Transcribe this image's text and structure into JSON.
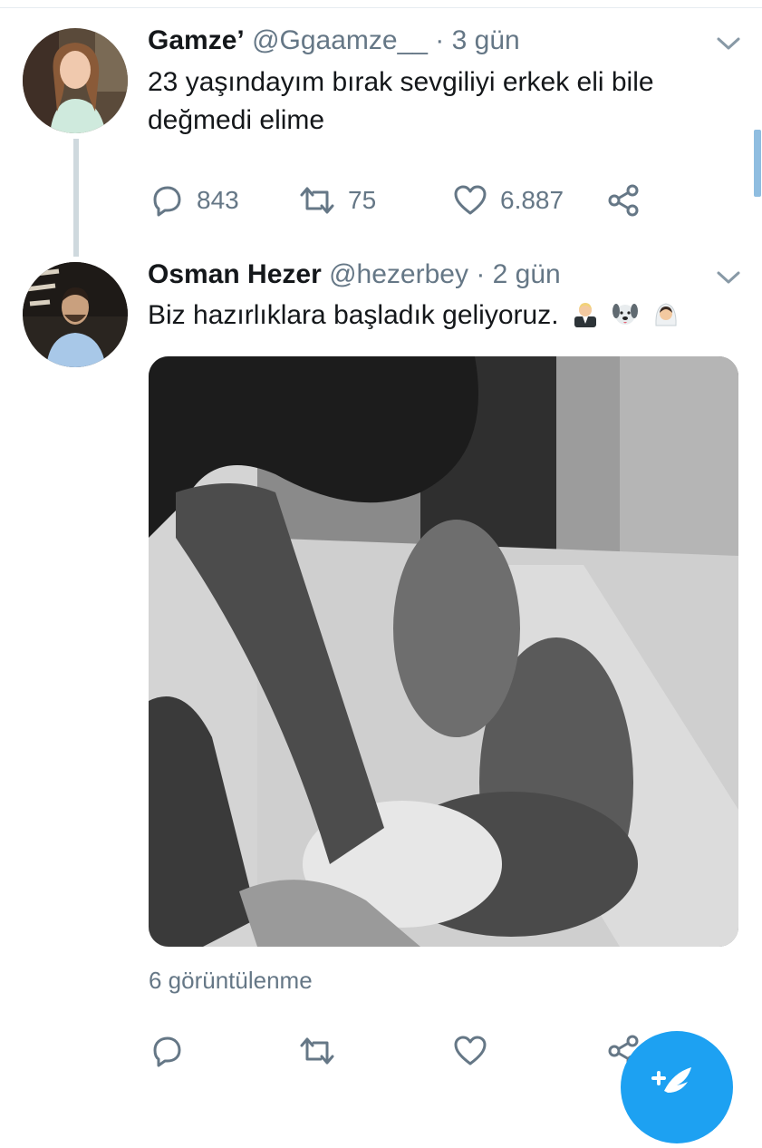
{
  "tweets": [
    {
      "name": "Gamze’",
      "handle": "@Ggaamze__",
      "separator": "·",
      "time": "3 gün",
      "text": "23 yaşındayım bırak sevgiliyi erkek eli bile değmedi elime",
      "replies": "843",
      "retweets": "75",
      "likes": "6.887"
    },
    {
      "name": "Osman Hezer",
      "handle": "@hezerbey",
      "separator": "·",
      "time": "2 gün",
      "text": "Biz hazırlıklara başladık geliyoruz.",
      "emojis": [
        "groom-emoji",
        "dog-emoji",
        "bride-emoji"
      ],
      "views": "6 görüntülenme"
    }
  ],
  "colors": {
    "accent": "#1da1f2",
    "secondary_text": "#657786",
    "primary_text": "#14171a"
  },
  "icons": [
    "reply-icon",
    "retweet-icon",
    "like-icon",
    "share-icon",
    "chevron-down-icon",
    "compose-tweet-icon"
  ]
}
